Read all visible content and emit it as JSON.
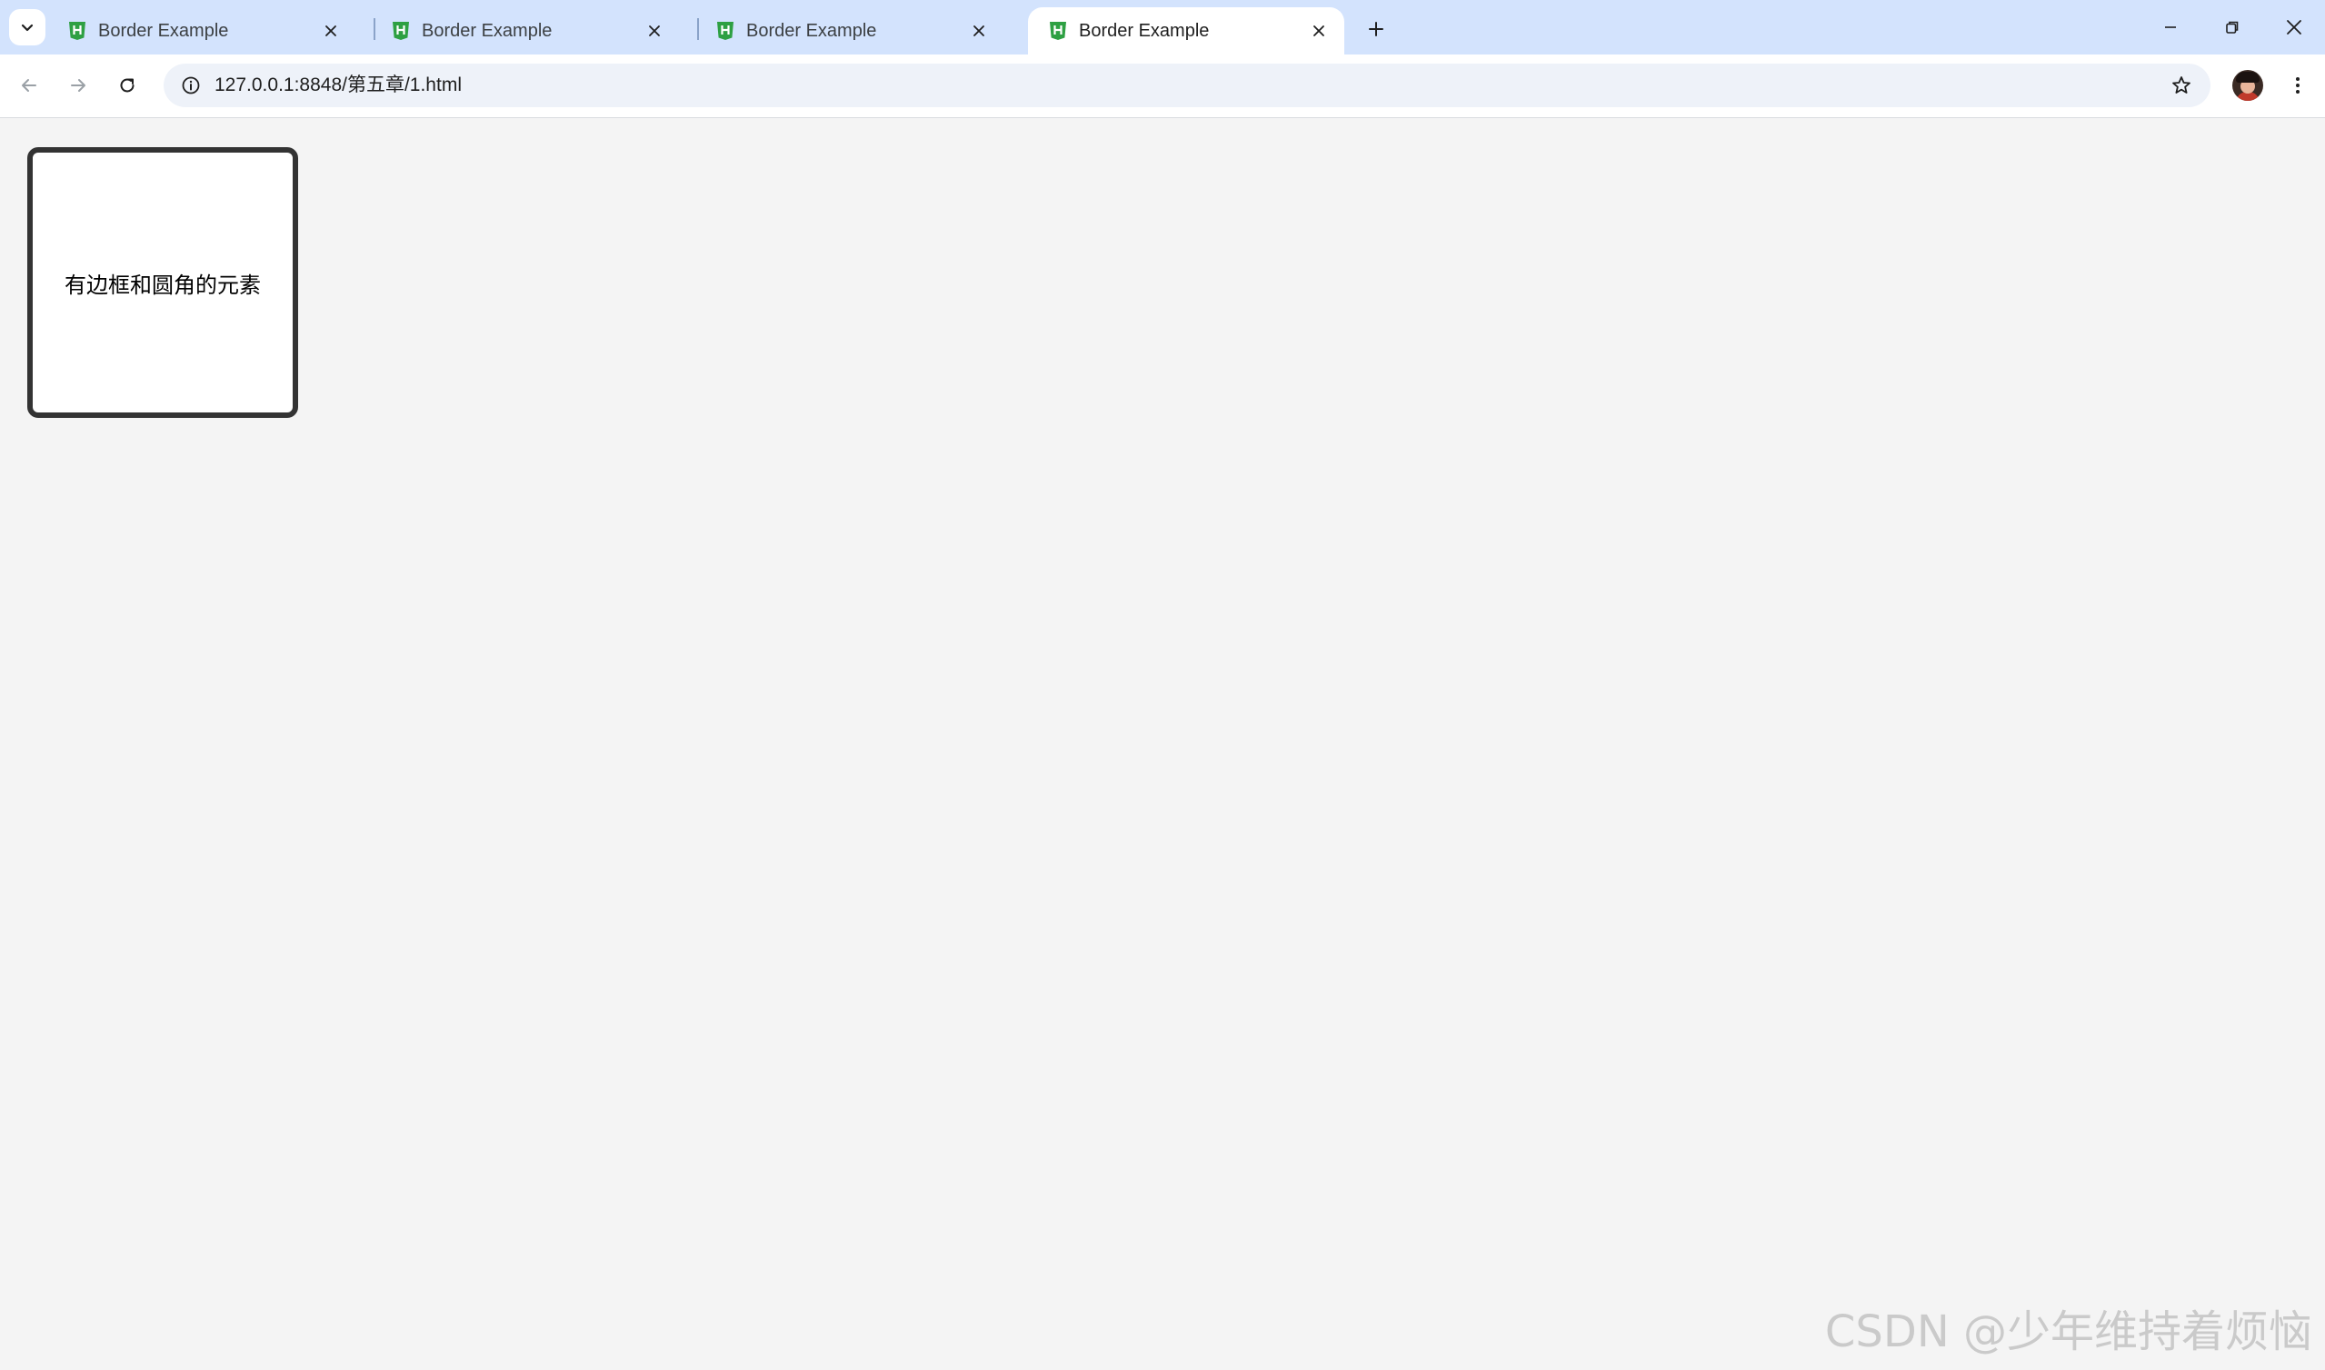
{
  "tabs": [
    {
      "title": "Border Example",
      "active": false
    },
    {
      "title": "Border Example",
      "active": false
    },
    {
      "title": "Border Example",
      "active": false
    },
    {
      "title": "Border Example",
      "active": true
    }
  ],
  "address_bar": {
    "url": "127.0.0.1:8848/第五章/1.html"
  },
  "content": {
    "box_text": "有边框和圆角的元素"
  },
  "watermark": "CSDN @少年维持着烦恼",
  "colors": {
    "tabstrip_bg": "#d3e3fd",
    "page_bg": "#f4f4f4",
    "box_border": "#333333",
    "favicon_green": "#2ea043"
  },
  "icons": {
    "tab_search": "chevron-down-icon",
    "favicon": "html5-hbuilder-icon",
    "tab_close": "close-icon",
    "new_tab": "plus-icon",
    "back": "arrow-left-icon",
    "forward": "arrow-right-icon",
    "reload": "reload-icon",
    "site_info": "info-icon",
    "bookmark": "star-icon",
    "menu": "kebab-icon"
  }
}
